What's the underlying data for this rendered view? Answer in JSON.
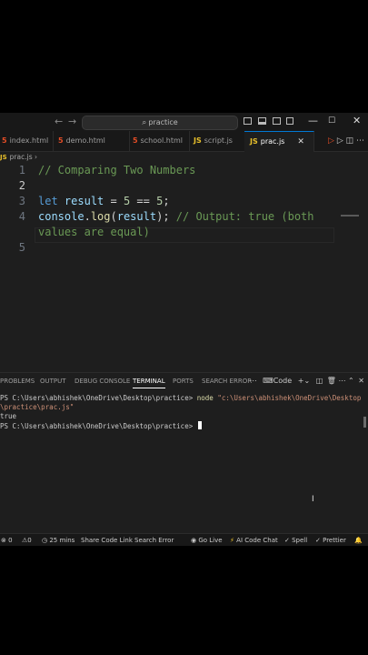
{
  "titlebar": {
    "search_placeholder": "practice",
    "back_glyph": "←",
    "forward_glyph": "→",
    "window_controls": {
      "minimize": "—",
      "maximize": "☐",
      "close": "✕"
    }
  },
  "tabs": [
    {
      "label": "index.html",
      "icon": "html5-icon",
      "glyph": "5"
    },
    {
      "label": "demo.html",
      "icon": "html5-icon",
      "glyph": "5"
    },
    {
      "label": "school.html",
      "icon": "html5-icon",
      "glyph": "5"
    },
    {
      "label": "script.js",
      "icon": "javascript-icon",
      "glyph": "JS"
    },
    {
      "label": "prac.js",
      "icon": "javascript-icon",
      "glyph": "JS",
      "active": true,
      "close": "✕"
    }
  ],
  "breadcrumb": {
    "file": "prac.js",
    "sep": "›"
  },
  "editor": {
    "line_numbers": [
      "1",
      "2",
      "3",
      "4",
      "5"
    ],
    "lines": {
      "l1": "// Comparing Two Numbers",
      "l3_kw": "let",
      "l3_var": "result",
      "l3_eq": " = ",
      "l3_n1": "5",
      "l3_op": " == ",
      "l3_n2": "5",
      "l3_end": ";",
      "l4_obj": "console",
      "l4_dot": ".",
      "l4_fn": "log",
      "l4_open": "(",
      "l4_arg": "result",
      "l4_close": ");",
      "l4_comment": "// Output: true (both",
      "l4_wrap": "values are equal)"
    }
  },
  "panel": {
    "tabs": [
      "PROBLEMS",
      "OUTPUT",
      "DEBUG CONSOLE",
      "TERMINAL",
      "PORTS",
      "SEARCH ERROR"
    ],
    "active_tab": "TERMINAL",
    "shell_label": "Code",
    "terminal": {
      "prompt1": "PS C:\\Users\\abhishek\\OneDrive\\Desktop\\practice>",
      "cmd": "node",
      "arg": "\"c:\\Users\\abhishek\\OneDrive\\Desktop",
      "arg_wrap": "\\practice\\prac.js\"",
      "output": "true",
      "prompt2": "PS C:\\Users\\abhishek\\OneDrive\\Desktop\\practice>"
    }
  },
  "statusbar": {
    "errors": "0",
    "warnings": "0",
    "time": "25 mins",
    "share": "Share Code Link",
    "search_error": "Search Error",
    "golive": "Go Live",
    "ai_chat": "AI Code Chat",
    "spell": "Spell",
    "prettier": "Prettier"
  }
}
